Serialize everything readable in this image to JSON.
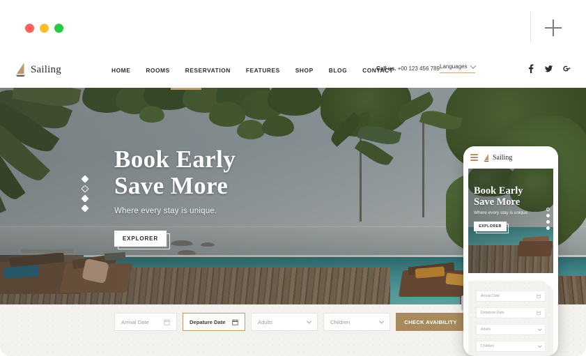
{
  "browser": {
    "traffic_lights": [
      {
        "name": "close",
        "color": "#ff6058"
      },
      {
        "name": "minimize",
        "color": "#ffbd2e"
      },
      {
        "name": "maximize",
        "color": "#28ca41"
      }
    ],
    "new_tab_icon": "plus-icon"
  },
  "site": {
    "brand": {
      "name": "Sailing",
      "icon": "sailboat-icon",
      "color": "#bc9a6a"
    },
    "nav_links": [
      {
        "label": "HOME",
        "active": false
      },
      {
        "label": "ROOMS",
        "active": false
      },
      {
        "label": "RESERVATION",
        "active": true
      },
      {
        "label": "FEATURES",
        "active": false
      },
      {
        "label": "SHOP",
        "active": false
      },
      {
        "label": "BLOG",
        "active": false
      },
      {
        "label": "CONTACT",
        "active": false
      }
    ],
    "call_us_label": "Call us.",
    "call_us_number": "+00 123 456 789",
    "languages_label": "Languages",
    "socials": [
      {
        "name": "facebook-icon"
      },
      {
        "name": "twitter-icon"
      },
      {
        "name": "google-plus-icon"
      }
    ],
    "accent_color": "#bc9a6a"
  },
  "hero": {
    "title_line1": "Book Early",
    "title_line2": "Save More",
    "subtitle": "Where every stay is unique.",
    "cta_label": "EXPLORER",
    "slider_dots": [
      {
        "active": false
      },
      {
        "active": true
      },
      {
        "active": false
      },
      {
        "active": false
      }
    ]
  },
  "booking": {
    "arrival": {
      "label": "Arrival Date",
      "icon": "calendar-icon",
      "active": false
    },
    "departure": {
      "label": "Depature Date",
      "icon": "calendar-icon",
      "active": true
    },
    "adults": {
      "label": "Adults",
      "icon": "chevron-down-icon"
    },
    "children": {
      "label": "Children",
      "icon": "chevron-down-icon"
    },
    "submit_label": "CHECK AVAIBILITY",
    "submit_color": "#a98a5e"
  },
  "phone": {
    "menu_icon": "hamburger-icon",
    "brand_name": "Sailing",
    "hero": {
      "title_line1": "Book Early",
      "title_line2": "Save More",
      "subtitle": "Where every stay is unique.",
      "cta_label": "EXPLORER",
      "slider_dots": [
        {
          "active": true
        },
        {
          "active": false
        },
        {
          "active": false
        },
        {
          "active": false
        }
      ]
    },
    "booking": {
      "arrival": {
        "label": "Arrival Date",
        "icon": "calendar-icon"
      },
      "departure": {
        "label": "Depature Date",
        "icon": "calendar-icon"
      },
      "adults": {
        "label": "Adults",
        "icon": "chevron-down-icon"
      },
      "children": {
        "label": "Children",
        "icon": "chevron-down-icon"
      }
    }
  }
}
